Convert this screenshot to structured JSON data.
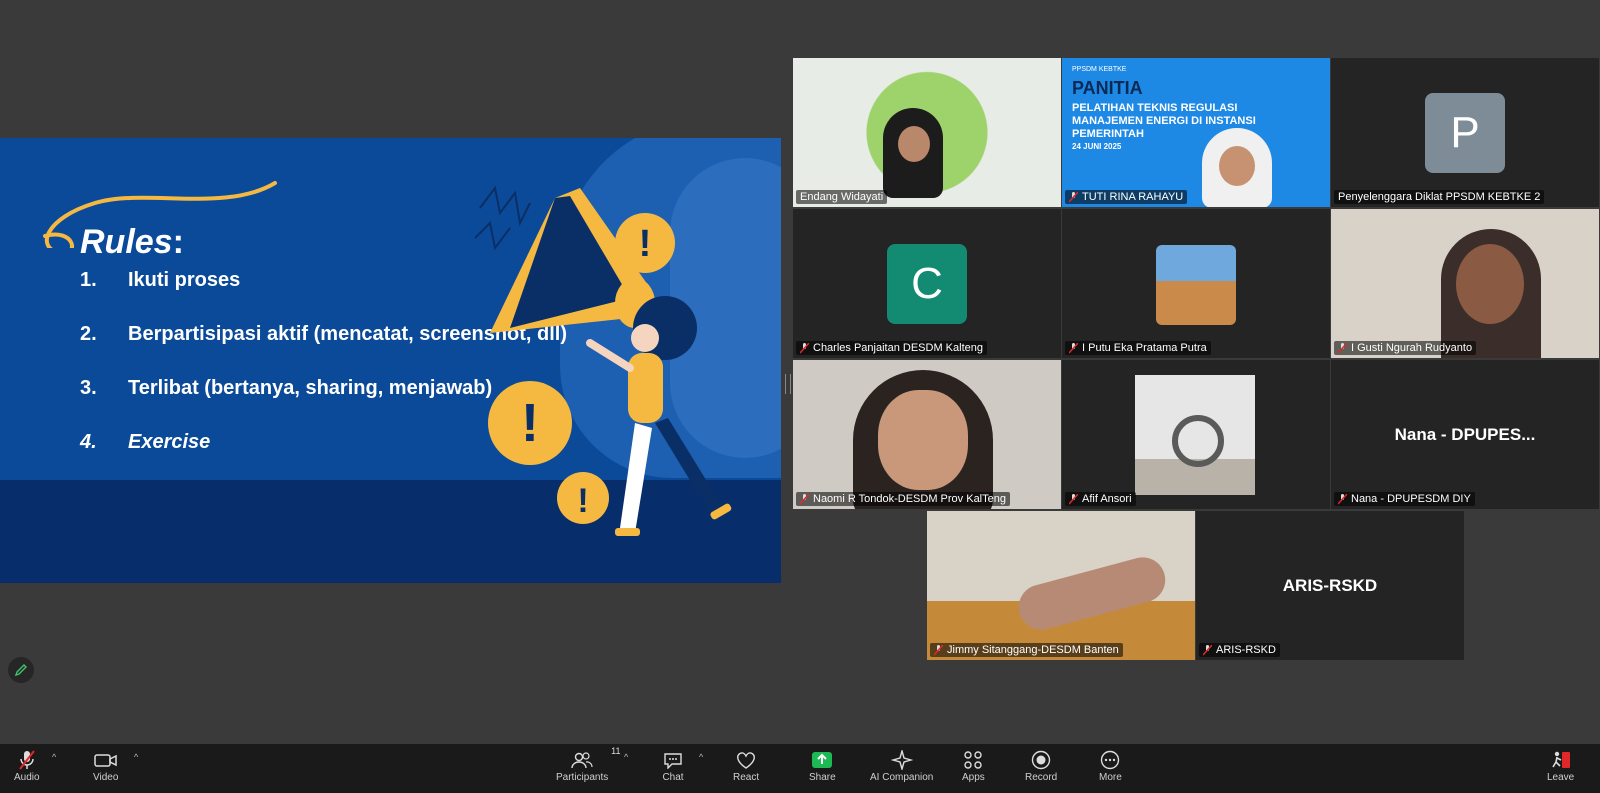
{
  "slide": {
    "rules_title": "Rules",
    "rules_colon": ":",
    "items": [
      {
        "num": "1.",
        "text": "Ikuti proses"
      },
      {
        "num": "2.",
        "text": "Berpartisipasi aktif (mencatat, screenshot, dll)"
      },
      {
        "num": "3.",
        "text": "Terlibat (bertanya, sharing, menjawab)"
      },
      {
        "num": "4.",
        "text": "Exercise"
      }
    ]
  },
  "participants_tiles": [
    {
      "name": "Endang Widayati",
      "muted": false,
      "video": "konservasi-energi-background"
    },
    {
      "name": "TUTI RINA RAHAYU",
      "muted": true,
      "banner_org": "PPSDM KEBTKE",
      "banner_title": "PANITIA",
      "banner_sub": "PELATIHAN TEKNIS REGULASI MANAJEMEN ENERGI DI INSTANSI PEMERINTAH",
      "banner_date": "24 JUNI 2025"
    },
    {
      "name": "Penyelenggara Diklat PPSDM KEBTKE 2",
      "muted": false,
      "avatar": "P",
      "avatar_color": "#7d8c97"
    },
    {
      "name": "Charles Panjaitan DESDM Kalteng",
      "muted": true,
      "avatar": "C",
      "avatar_color": "#138a72"
    },
    {
      "name": "I Putu Eka Pratama Putra",
      "muted": true,
      "video": "profile-photo"
    },
    {
      "name": "I Gusti Ngurah Rudyanto",
      "muted": true,
      "video": "camera"
    },
    {
      "name": "Naomi R Tondok-DESDM Prov KalTeng",
      "muted": true,
      "video": "camera"
    },
    {
      "name": "Afif Ansori",
      "muted": true,
      "video": "profile-photo"
    },
    {
      "name": "Nana - DPUPESDM DIY",
      "muted": true,
      "display": "Nana - DPUPES..."
    },
    {
      "name": "Jimmy Sitanggang-DESDM Banten",
      "muted": true,
      "video": "camera"
    },
    {
      "name": "ARIS-RSKD",
      "muted": true,
      "display": "ARIS-RSKD"
    }
  ],
  "toolbar": {
    "audio": "Audio",
    "video": "Video",
    "participants": "Participants",
    "participants_count": "11",
    "chat": "Chat",
    "react": "React",
    "share": "Share",
    "ai_companion": "AI Companion",
    "apps": "Apps",
    "record": "Record",
    "more": "More",
    "leave": "Leave"
  },
  "colors": {
    "slide_bg": "#0b4a99",
    "accent_yellow": "#f5b942",
    "share_green": "#1db954",
    "leave_red": "#e02828",
    "active_speaker": "#2ec27e"
  }
}
